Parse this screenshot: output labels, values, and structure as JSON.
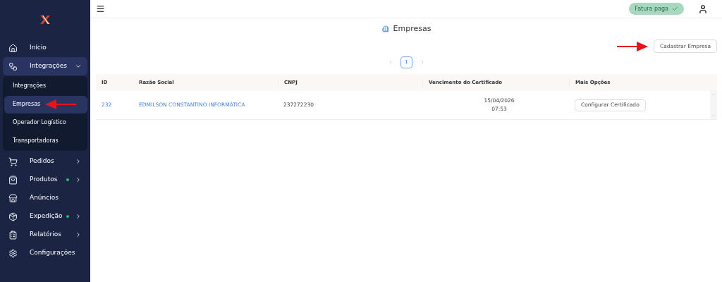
{
  "sidebar": {
    "items": [
      {
        "label": "Início",
        "selected": false
      },
      {
        "label": "Integrações",
        "selected": false,
        "expanded": true,
        "children": [
          {
            "label": "Integrações",
            "selected": false
          },
          {
            "label": "Empresas",
            "selected": true
          },
          {
            "label": "Operador Logístico",
            "selected": false
          },
          {
            "label": "Transportadoras",
            "selected": false
          }
        ]
      },
      {
        "label": "Pedidos",
        "selected": false,
        "expanded": false
      },
      {
        "label": "Produtos",
        "selected": false,
        "expanded": false,
        "dot": true
      },
      {
        "label": "Anúncios",
        "selected": false
      },
      {
        "label": "Expedição",
        "selected": false,
        "expanded": false,
        "dot": true
      },
      {
        "label": "Relatórios",
        "selected": false,
        "expanded": false
      },
      {
        "label": "Configurações",
        "selected": false
      }
    ]
  },
  "header": {
    "status_badge": "Fatura paga"
  },
  "page": {
    "title": "Empresas",
    "add_button": "Cadastrar Empresa"
  },
  "pagination": {
    "pages": [
      {
        "label": "1",
        "selected": true
      }
    ]
  },
  "table": {
    "columns": [
      "ID",
      "Razão Social",
      "CNPJ",
      "Vencimento do Certificado",
      "Mais Opções"
    ],
    "rows": [
      {
        "id": "232",
        "name": "EDMILSON CONSTANTINO INFORMÁTICA",
        "cnpj": "237272230",
        "expiry_date": "15/04/2026",
        "expiry_time": "07:53",
        "action": "Configurar Certificado"
      }
    ]
  }
}
